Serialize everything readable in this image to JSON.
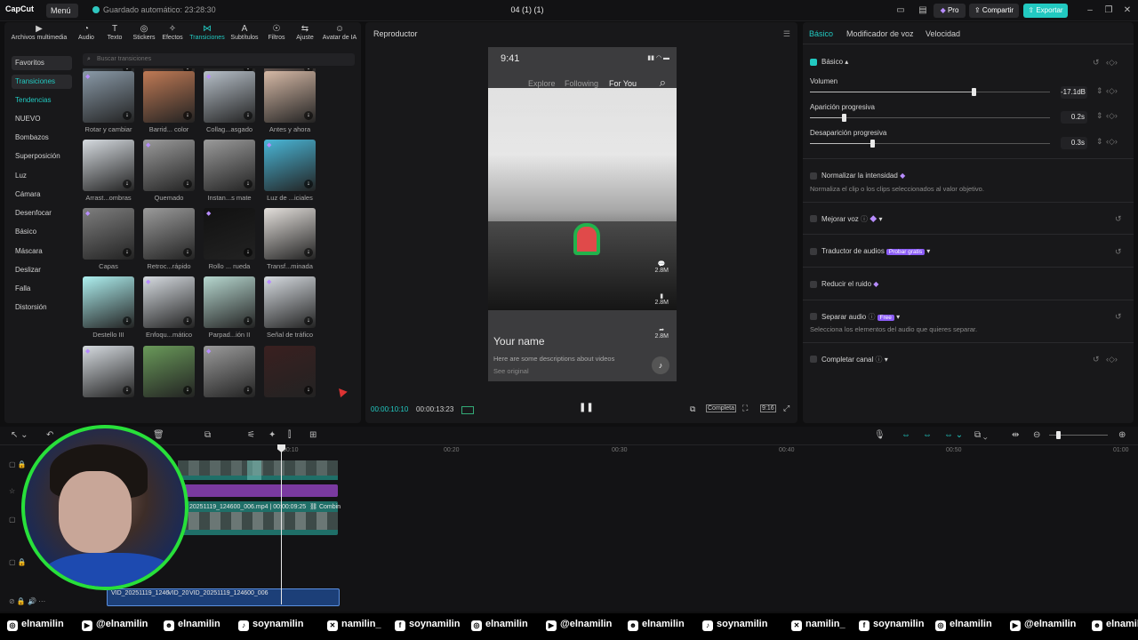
{
  "app": {
    "logo": "CapCut",
    "menu_label": "Menú",
    "autosave": "Guardado automático: 23:28:30",
    "project_title": "04 (1) (1)",
    "pro_label": "Pro",
    "share_label": "Compartir",
    "export_label": "Exportar"
  },
  "toolbar": [
    {
      "label": "Archivos multimedia",
      "icon": "media-icon"
    },
    {
      "label": "Audio",
      "icon": "audio-icon"
    },
    {
      "label": "Texto",
      "icon": "text-icon"
    },
    {
      "label": "Stickers",
      "icon": "sticker-icon"
    },
    {
      "label": "Efectos",
      "icon": "effects-icon"
    },
    {
      "label": "Transiciones",
      "icon": "transitions-icon",
      "active": true
    },
    {
      "label": "Subtítulos",
      "icon": "subtitles-icon"
    },
    {
      "label": "Filtros",
      "icon": "filters-icon"
    },
    {
      "label": "Ajuste",
      "icon": "adjust-icon"
    },
    {
      "label": "Avatar de IA",
      "icon": "ai-avatar-icon"
    }
  ],
  "categories": [
    "Favoritos",
    "Transiciones",
    "Tendencias",
    "NUEVO",
    "Bombazos",
    "Superposición",
    "Luz",
    "Cámara",
    "Desenfocar",
    "Básico",
    "Máscara",
    "Deslizar",
    "Falla",
    "Distorsión"
  ],
  "search_placeholder": "Buscar transiciones",
  "transitions": [
    {
      "label": "Desliz... abajo"
    },
    {
      "label": "Revela...léfono"
    },
    {
      "label": "Paso d... negra"
    },
    {
      "label": "Desdob...igonal"
    },
    {
      "label": "Rotar y cambiar"
    },
    {
      "label": "Barrid... color"
    },
    {
      "label": "Collag...asgado"
    },
    {
      "label": "Antes y ahora"
    },
    {
      "label": "Arrast...ombras"
    },
    {
      "label": "Quemado"
    },
    {
      "label": "Instan...s mate"
    },
    {
      "label": "Luz de ...iciales"
    },
    {
      "label": "Capas"
    },
    {
      "label": "Retroc...rápido"
    },
    {
      "label": "Rollo ... rueda"
    },
    {
      "label": "Transf...minada"
    },
    {
      "label": "Destello III"
    },
    {
      "label": "Enfoqu...mático"
    },
    {
      "label": "Parpad...ión II"
    },
    {
      "label": "Señal de tráfico"
    },
    {
      "label": ""
    },
    {
      "label": ""
    },
    {
      "label": ""
    },
    {
      "label": ""
    }
  ],
  "player": {
    "title": "Reproductor",
    "phone_time": "9:41",
    "tabs": [
      "Explore",
      "Following",
      "For You"
    ],
    "stat1": "2.8M",
    "stat2": "2.8M",
    "stat3": "2.8M",
    "name": "Your name",
    "description": "Here are some descriptions about videos",
    "see_original": "See original",
    "time_current": "00:00:10:10",
    "time_total": "00:00:13:23",
    "full_label": "Completa",
    "ratio_label": "9:16"
  },
  "inspector": {
    "tabs": [
      "Básico",
      "Modificador de voz",
      "Velocidad"
    ],
    "basic_label": "Básico",
    "volume_label": "Volumen",
    "volume_value": "-17.1dB",
    "volume_level": 0.68,
    "fade_in_label": "Aparición progresiva",
    "fade_in_value": "0.2s",
    "fade_in_level": 0.14,
    "fade_out_label": "Desaparición progresiva",
    "fade_out_value": "0.3s",
    "fade_out_level": 0.26,
    "normalize_label": "Normalizar la intensidad",
    "normalize_desc": "Normaliza el clip o los clips seleccionados al valor objetivo.",
    "enhance_label": "Mejorar voz",
    "translate_label": "Traductor de audios",
    "translate_badge": "Probar gratis",
    "denoise_label": "Reducir el ruido",
    "separate_label": "Separar audio",
    "separate_badge": "Free",
    "separate_desc": "Selecciona los elementos del audio que quieres separar.",
    "complete_label": "Completar canal"
  },
  "timeline": {
    "ruler": [
      "00:10",
      "00:20",
      "00:30",
      "00:40",
      "00:50",
      "01:00"
    ],
    "clip_name": "20251119_124600_006.mp4",
    "clip_duration": "00:00:09:25",
    "clip_tag": "Combin",
    "audio_clip_1": "VID_20251119_1246",
    "audio_clip_2": "VID_20",
    "audio_clip_3": "VID_20251119_124600_006"
  },
  "social": [
    {
      "icon": "instagram-icon",
      "handle": "elnamilin"
    },
    {
      "icon": "youtube-icon",
      "handle": "@elnamilin"
    },
    {
      "icon": "discord-icon",
      "handle": "elnamilin"
    },
    {
      "icon": "tiktok-icon",
      "handle": "soynamilin"
    },
    {
      "icon": "x-icon",
      "handle": "namilin_"
    },
    {
      "icon": "facebook-icon",
      "handle": "soynamilin"
    },
    {
      "icon": "instagram-icon",
      "handle": "elnamilin"
    },
    {
      "icon": "youtube-icon",
      "handle": "@elnamilin"
    },
    {
      "icon": "discord-icon",
      "handle": "elnamilin"
    },
    {
      "icon": "tiktok-icon",
      "handle": "soynamilin"
    },
    {
      "icon": "x-icon",
      "handle": "namilin_"
    },
    {
      "icon": "facebook-icon",
      "handle": "soynamilin"
    },
    {
      "icon": "instagram-icon",
      "handle": "elnamilin"
    },
    {
      "icon": "youtube-icon",
      "handle": "@elnamilin"
    },
    {
      "icon": "discord-icon",
      "handle": "elnamilin"
    }
  ]
}
